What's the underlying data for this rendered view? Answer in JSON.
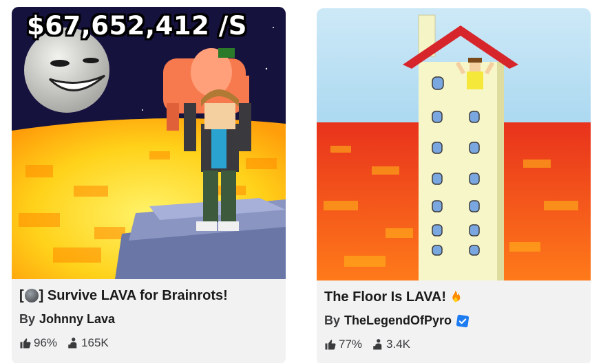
{
  "games": [
    {
      "title_prefix": "[",
      "title_suffix": "] Survive LAVA for Brainrots!",
      "title_emoji": "moon-emoji",
      "by_label": "By",
      "creator": "Johnny Lava",
      "verified": false,
      "rating": "96%",
      "players": "165K",
      "thumbnail_text": "$67,652,412 /S"
    },
    {
      "title": "The Floor Is LAVA!",
      "title_emoji": "fire-emoji",
      "by_label": "By",
      "creator": "TheLegendOfPyro",
      "verified": true,
      "rating": "77%",
      "players": "3.4K"
    }
  ],
  "icons": {
    "rating": "thumbs-up-icon",
    "players": "players-icon",
    "verified": "verified-badge-icon"
  },
  "colors": {
    "card_bg": "#f2f2f3",
    "verified_blue": "#1d7cf2",
    "lava_yellow": "#ffd21a",
    "lava_red": "#e8321c"
  }
}
